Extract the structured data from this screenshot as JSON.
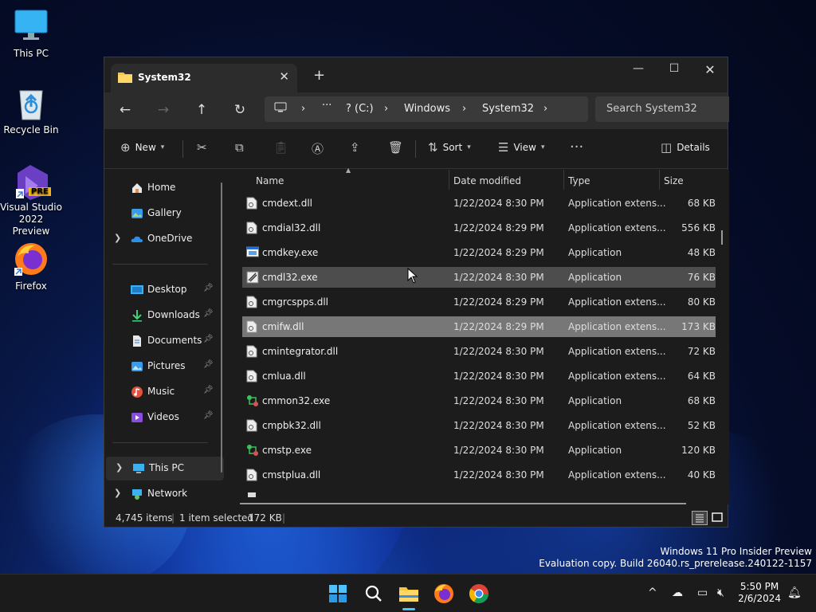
{
  "desktop": {
    "icons": [
      {
        "label": "This PC"
      },
      {
        "label": "Recycle Bin"
      },
      {
        "label_line1": "Visual Studio",
        "label_line2": "2022 Preview",
        "badge": "PRE"
      },
      {
        "label": "Firefox"
      }
    ]
  },
  "window": {
    "tab_title": "System32",
    "breadcrumb": [
      "? (C:)",
      "Windows",
      "System32"
    ],
    "search_placeholder": "Search System32",
    "toolbar": {
      "new_label": "New",
      "sort_label": "Sort",
      "view_label": "View",
      "details_label": "Details"
    }
  },
  "nav_pane": {
    "top": [
      {
        "label": "Home",
        "icon": "home-icon"
      },
      {
        "label": "Gallery",
        "icon": "gallery-icon"
      },
      {
        "label": "OneDrive",
        "icon": "onedrive-icon"
      }
    ],
    "quick_access": [
      {
        "label": "Desktop",
        "icon": "desktop-folder-icon"
      },
      {
        "label": "Downloads",
        "icon": "downloads-icon"
      },
      {
        "label": "Documents",
        "icon": "documents-icon"
      },
      {
        "label": "Pictures",
        "icon": "pictures-icon"
      },
      {
        "label": "Music",
        "icon": "music-icon"
      },
      {
        "label": "Videos",
        "icon": "videos-icon"
      }
    ],
    "bottom": [
      {
        "label": "This PC",
        "icon": "this-pc-icon"
      },
      {
        "label": "Network",
        "icon": "network-icon"
      }
    ]
  },
  "columns": {
    "name": "Name",
    "date": "Date modified",
    "type": "Type",
    "size": "Size"
  },
  "files": [
    {
      "name": "cmdext.dll",
      "date": "1/22/2024 8:30 PM",
      "type": "Application extens...",
      "size": "68 KB",
      "kind": "dll"
    },
    {
      "name": "cmdial32.dll",
      "date": "1/22/2024 8:29 PM",
      "type": "Application extens...",
      "size": "556 KB",
      "kind": "dll"
    },
    {
      "name": "cmdkey.exe",
      "date": "1/22/2024 8:29 PM",
      "type": "Application",
      "size": "48 KB",
      "kind": "exe"
    },
    {
      "name": "cmdl32.exe",
      "date": "1/22/2024 8:30 PM",
      "type": "Application",
      "size": "76 KB",
      "kind": "exe2"
    },
    {
      "name": "cmgrcspps.dll",
      "date": "1/22/2024 8:29 PM",
      "type": "Application extens...",
      "size": "80 KB",
      "kind": "dll"
    },
    {
      "name": "cmifw.dll",
      "date": "1/22/2024 8:29 PM",
      "type": "Application extens...",
      "size": "173 KB",
      "kind": "dll"
    },
    {
      "name": "cmintegrator.dll",
      "date": "1/22/2024 8:30 PM",
      "type": "Application extens...",
      "size": "72 KB",
      "kind": "dll"
    },
    {
      "name": "cmlua.dll",
      "date": "1/22/2024 8:30 PM",
      "type": "Application extens...",
      "size": "64 KB",
      "kind": "dll"
    },
    {
      "name": "cmmon32.exe",
      "date": "1/22/2024 8:30 PM",
      "type": "Application",
      "size": "68 KB",
      "kind": "exe3"
    },
    {
      "name": "cmpbk32.dll",
      "date": "1/22/2024 8:30 PM",
      "type": "Application extens...",
      "size": "52 KB",
      "kind": "dll"
    },
    {
      "name": "cmstp.exe",
      "date": "1/22/2024 8:30 PM",
      "type": "Application",
      "size": "120 KB",
      "kind": "exe3"
    },
    {
      "name": "cmstplua.dll",
      "date": "1/22/2024 8:30 PM",
      "type": "Application extens...",
      "size": "40 KB",
      "kind": "dll"
    }
  ],
  "status": {
    "item_count": "4,745 items",
    "selection": "1 item selected",
    "selection_size": "172 KB"
  },
  "watermark": {
    "line1": "Windows 11 Pro Insider Preview",
    "line2": "Evaluation copy. Build 26040.rs_prerelease.240122-1157"
  },
  "taskbar": {
    "time": "5:50 PM",
    "date": "2/6/2024"
  },
  "colors": {
    "accent": "#0078d4",
    "selected_row": "#777777",
    "hover_row": "#4d4d4d"
  }
}
